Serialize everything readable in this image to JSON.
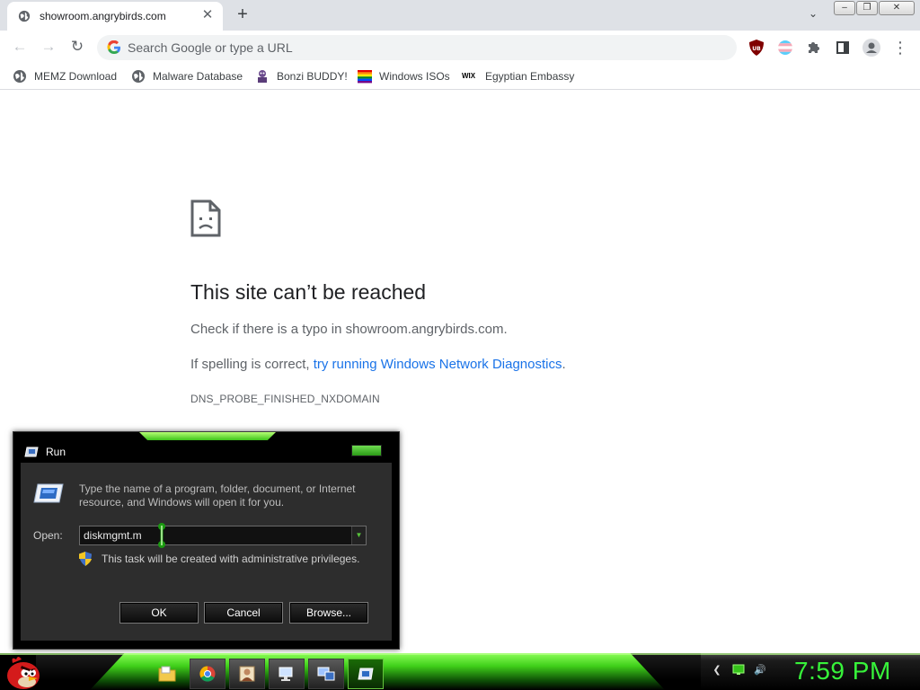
{
  "browser": {
    "tab": {
      "title": "showroom.angrybirds.com",
      "favicon": "globe-icon",
      "close_glyph": "✕"
    },
    "new_tab_glyph": "+",
    "tab_search_glyph": "⌄",
    "window_controls": {
      "minimize": "–",
      "restore": "❐",
      "close": "✕"
    },
    "nav": {
      "back_glyph": "←",
      "forward_glyph": "→",
      "reload_glyph": "↻"
    },
    "omnibox": {
      "placeholder": "Search Google or type a URL",
      "value": ""
    },
    "extensions": [
      "ublock-origin-icon",
      "extension-flag-icon",
      "puzzle-extensions-icon",
      "side-panel-icon",
      "profile-avatar-icon",
      "more-menu-icon"
    ],
    "ublock_label": "UB",
    "menu_glyph": "⋮",
    "bookmarks": [
      {
        "label": "MEMZ Download",
        "icon": "globe-icon"
      },
      {
        "label": "Malware Database",
        "icon": "globe-icon"
      },
      {
        "label": "Bonzi BUDDY!",
        "icon": "bonzi-icon"
      },
      {
        "label": "Windows ISOs",
        "icon": "rainbow-icon"
      },
      {
        "label": "Egyptian Embassy",
        "icon": "wix-icon"
      }
    ],
    "wix_label": "WIX"
  },
  "error_page": {
    "icon": "sad-page-icon",
    "title": "This site can’t be reached",
    "typo_prefix": "Check if there is a typo in ",
    "typo_domain": "showroom.angrybirds.com",
    "typo_suffix": ".",
    "spelling_prefix": "If spelling is correct, ",
    "spelling_link": "try running Windows Network Diagnostics",
    "spelling_suffix": ".",
    "code": "DNS_PROBE_FINISHED_NXDOMAIN"
  },
  "run_dialog": {
    "title": "Run",
    "description": "Type the name of a program, folder, document, or Internet resource, and Windows will open it for you.",
    "open_label": "Open:",
    "input_value": "diskmgmt.m",
    "dropdown_glyph": "▼",
    "admin_note": "This task will be created with administrative privileges.",
    "buttons": {
      "ok": "OK",
      "cancel": "Cancel",
      "browse": "Browse..."
    }
  },
  "taskbar": {
    "items": [
      "folder-icon",
      "chrome-icon",
      "portrait-icon",
      "computer-icon",
      "network-computer-icon",
      "run-icon"
    ],
    "active_item": "run-icon",
    "tray": [
      "expand-tray-icon",
      "battery-icon",
      "volume-icon"
    ],
    "tray_expand_glyph": "❮",
    "tray_volume_glyph": "🔊",
    "clock": "7:59 PM",
    "clock_color": "#37f33a"
  },
  "colors": {
    "accent_green": "#3fcf1a",
    "link_blue": "#1a73e8",
    "chrome_gray": "#dee1e6"
  }
}
